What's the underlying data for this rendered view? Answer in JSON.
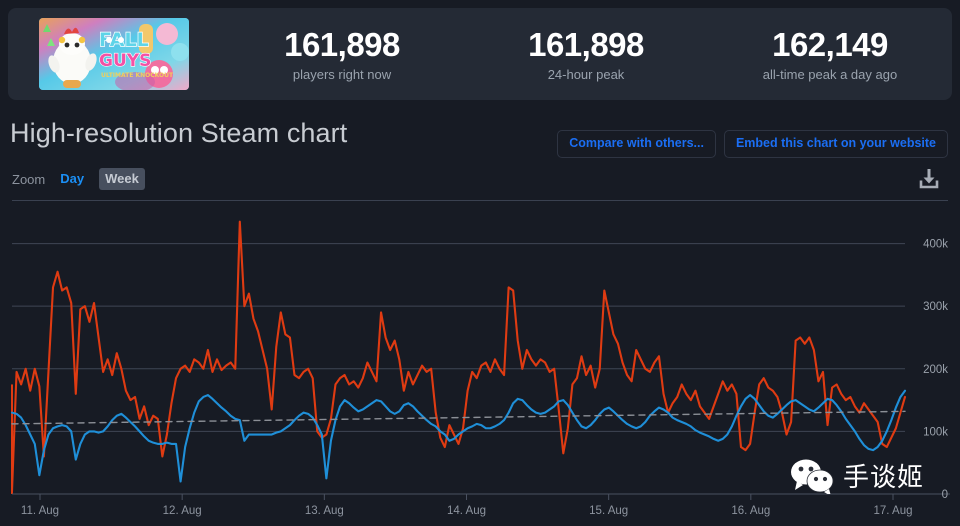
{
  "header": {
    "thumbnail": {
      "name": "fall-guys-thumbnail",
      "title_line1": "FALL",
      "title_line2": "GUYS",
      "title_line3": "ULTIMATE KNOCKOUT"
    },
    "stats": [
      {
        "value": "161,898",
        "label": "players right now"
      },
      {
        "value": "161,898",
        "label": "24-hour peak"
      },
      {
        "value": "162,149",
        "label": "all-time peak a day ago"
      }
    ]
  },
  "page_title": "High-resolution Steam chart",
  "buttons": {
    "compare": "Compare with others...",
    "embed": "Embed this chart on your website"
  },
  "zoom_control": {
    "label": "Zoom",
    "options": [
      {
        "label": "Day",
        "selected": false
      },
      {
        "label": "Week",
        "selected": true
      }
    ]
  },
  "download": {
    "icon": "download-icon"
  },
  "colors": {
    "page_bg": "#171b24",
    "card_bg": "#242a35",
    "accent_blue": "#1b6ef3",
    "series_red": "#df3b12",
    "series_blue": "#1f8fd8",
    "series_dashed": "#8b8f96",
    "gridline": "#3f4654"
  },
  "watermark": {
    "text": "手谈姬",
    "icon": "wechat-icon"
  },
  "chart_data": {
    "type": "line",
    "title": "High-resolution Steam chart",
    "xlabel": "",
    "ylabel": "",
    "ylim": [
      0,
      460000
    ],
    "yticks": [
      0,
      100000,
      200000,
      300000,
      400000
    ],
    "ytick_labels": [
      "0",
      "100k",
      "200k",
      "300k",
      "400k"
    ],
    "grid": true,
    "legend": "none",
    "x": [
      "11. Aug",
      "12. Aug",
      "13. Aug",
      "14. Aug",
      "15. Aug",
      "16. Aug",
      "17. Aug"
    ],
    "xtick_labels": [
      "11. Aug",
      "12. Aug",
      "13. Aug",
      "14. Aug",
      "15. Aug",
      "16. Aug",
      "17. Aug"
    ],
    "series": [
      {
        "name": "players-red",
        "color": "#df3b12",
        "values": [
          5000,
          195000,
          175000,
          200000,
          165000,
          200000,
          172000,
          60000,
          195000,
          330000,
          355000,
          325000,
          330000,
          305000,
          160000,
          295000,
          300000,
          275000,
          305000,
          250000,
          195000,
          215000,
          190000,
          225000,
          200000,
          165000,
          150000,
          155000,
          120000,
          140000,
          110000,
          125000,
          120000,
          60000,
          95000,
          145000,
          185000,
          200000,
          205000,
          195000,
          215000,
          210000,
          200000,
          230000,
          195000,
          215000,
          198000,
          205000,
          210000,
          200000,
          435000,
          300000,
          320000,
          280000,
          260000,
          230000,
          200000,
          135000,
          235000,
          290000,
          255000,
          250000,
          190000,
          185000,
          195000,
          200000,
          185000,
          100000,
          90000,
          95000,
          120000,
          175000,
          185000,
          190000,
          175000,
          180000,
          170000,
          185000,
          210000,
          195000,
          180000,
          290000,
          250000,
          230000,
          245000,
          215000,
          165000,
          195000,
          175000,
          190000,
          205000,
          195000,
          200000,
          130000,
          90000,
          75000,
          110000,
          95000,
          80000,
          105000,
          165000,
          195000,
          185000,
          205000,
          210000,
          195000,
          215000,
          200000,
          190000,
          330000,
          325000,
          245000,
          200000,
          230000,
          215000,
          205000,
          215000,
          210000,
          195000,
          200000,
          135000,
          65000,
          105000,
          175000,
          185000,
          220000,
          190000,
          205000,
          170000,
          200000,
          325000,
          290000,
          255000,
          240000,
          210000,
          190000,
          180000,
          230000,
          215000,
          200000,
          195000,
          210000,
          220000,
          160000,
          130000,
          145000,
          155000,
          175000,
          160000,
          150000,
          165000,
          140000,
          130000,
          120000,
          140000,
          160000,
          180000,
          165000,
          175000,
          160000,
          75000,
          70000,
          80000,
          130000,
          175000,
          185000,
          170000,
          165000,
          155000,
          130000,
          95000,
          115000,
          245000,
          250000,
          240000,
          250000,
          230000,
          180000,
          195000,
          110000,
          170000,
          175000,
          160000,
          150000,
          155000,
          140000,
          130000,
          145000,
          135000,
          125000,
          115000,
          80000,
          75000,
          90000,
          105000,
          130000,
          155000
        ]
      },
      {
        "name": "average-blue",
        "color": "#1f8fd8",
        "values": [
          130000,
          128000,
          122000,
          110000,
          95000,
          80000,
          30000,
          70000,
          95000,
          105000,
          108000,
          110000,
          108000,
          100000,
          55000,
          80000,
          95000,
          100000,
          100000,
          98000,
          100000,
          108000,
          118000,
          125000,
          128000,
          122000,
          115000,
          108000,
          100000,
          92000,
          85000,
          82000,
          80000,
          80000,
          82000,
          80000,
          80000,
          20000,
          75000,
          105000,
          130000,
          148000,
          155000,
          158000,
          152000,
          145000,
          138000,
          132000,
          125000,
          120000,
          118000,
          85000,
          95000,
          95000,
          95000,
          95000,
          95000,
          95000,
          98000,
          100000,
          105000,
          110000,
          118000,
          125000,
          130000,
          128000,
          122000,
          110000,
          95000,
          25000,
          85000,
          118000,
          140000,
          150000,
          145000,
          138000,
          132000,
          135000,
          140000,
          145000,
          150000,
          148000,
          140000,
          132000,
          128000,
          132000,
          142000,
          145000,
          140000,
          132000,
          125000,
          118000,
          112000,
          108000,
          100000,
          95000,
          85000,
          88000,
          95000,
          100000,
          105000,
          108000,
          112000,
          110000,
          105000,
          105000,
          108000,
          112000,
          118000,
          130000,
          145000,
          152000,
          150000,
          142000,
          135000,
          130000,
          128000,
          130000,
          135000,
          140000,
          148000,
          150000,
          142000,
          130000,
          118000,
          108000,
          105000,
          110000,
          118000,
          128000,
          135000,
          138000,
          132000,
          125000,
          118000,
          112000,
          108000,
          105000,
          108000,
          115000,
          125000,
          132000,
          138000,
          135000,
          130000,
          122000,
          118000,
          115000,
          112000,
          108000,
          102000,
          98000,
          95000,
          92000,
          88000,
          85000,
          88000,
          95000,
          108000,
          125000,
          140000,
          152000,
          158000,
          152000,
          142000,
          132000,
          125000,
          122000,
          128000,
          135000,
          142000,
          148000,
          150000,
          145000,
          140000,
          135000,
          132000,
          138000,
          145000,
          152000,
          150000,
          142000,
          132000,
          120000,
          110000,
          100000,
          88000,
          78000,
          72000,
          70000,
          75000,
          85000,
          100000,
          118000,
          138000,
          155000,
          165000
        ]
      },
      {
        "name": "trend-dashed",
        "color": "#8b8f96",
        "dashed": true,
        "values": [
          112000,
          112400,
          112800,
          113200,
          113600,
          114000,
          114400,
          114800,
          115200,
          115600,
          116000,
          116400,
          116800,
          117200,
          117600,
          118000,
          118400,
          118800,
          119200,
          119600,
          120000,
          120400,
          120800,
          121200,
          121600,
          122000,
          122400,
          122800,
          123200,
          123600,
          124000,
          124400,
          124800,
          125200,
          125600,
          126000,
          126400,
          126800,
          127200,
          127600,
          128000,
          128400,
          128800,
          129200,
          129600,
          130000,
          130400,
          130800,
          131200,
          131600,
          132000
        ]
      }
    ]
  }
}
